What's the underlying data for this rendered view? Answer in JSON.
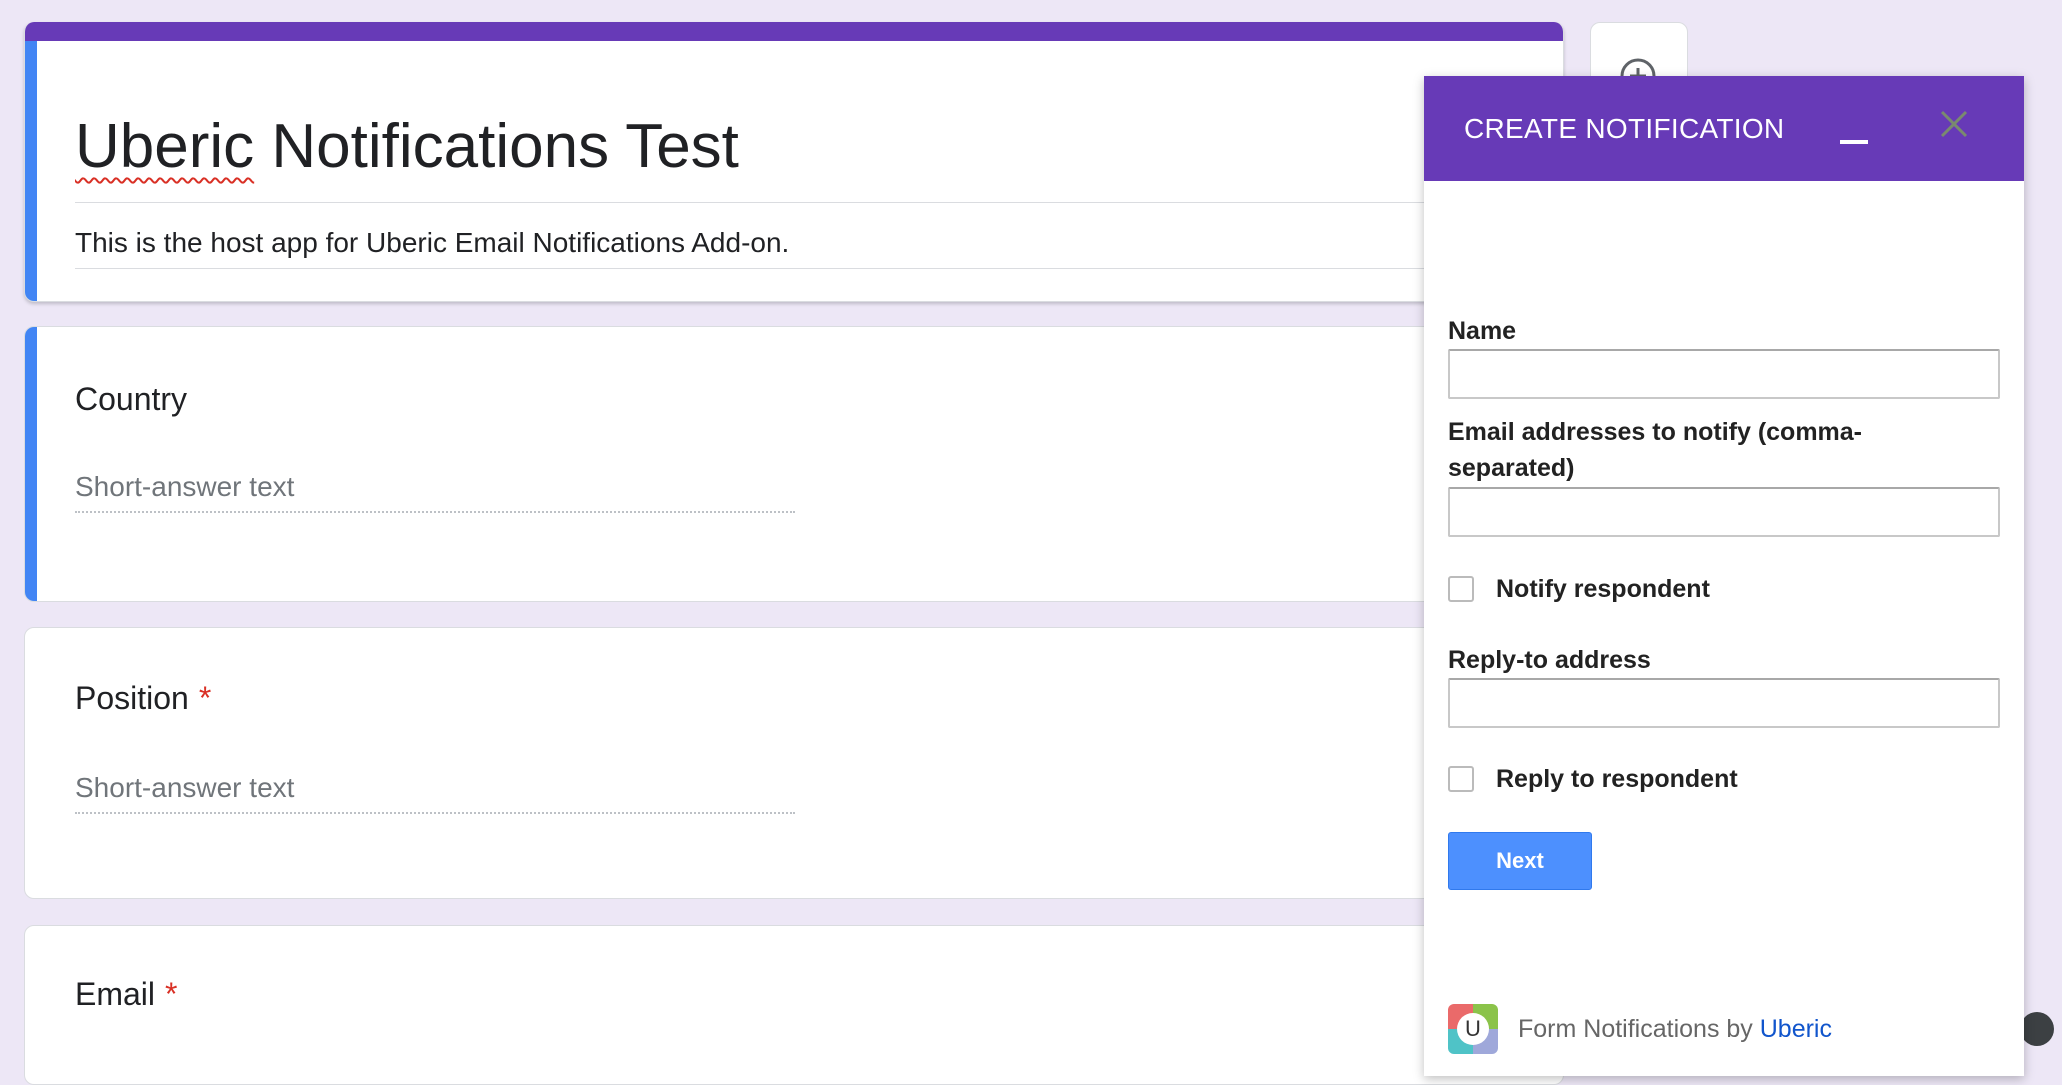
{
  "form": {
    "title": {
      "misspelled_word": "Uberic",
      "rest": " Notifications Test"
    },
    "description": "This is the host app for Uberic Email Notifications Add-on.",
    "questions": [
      {
        "title": "Country",
        "required_mark": "",
        "placeholder": "Short-answer text"
      },
      {
        "title": "Position",
        "required_mark": "*",
        "placeholder": "Short-answer text"
      },
      {
        "title": "Email",
        "required_mark": "*"
      }
    ]
  },
  "toolbar": {
    "add_icon": "add-circle-icon"
  },
  "sidebar": {
    "title": "CREATE NOTIFICATION",
    "minimize_icon": "minimize-icon",
    "close_icon": "close-icon",
    "fields": {
      "name_label": "Name",
      "name_value": "",
      "emails_label": "Email addresses to notify (comma-separated)",
      "emails_value": "",
      "notify_respondent_label": "Notify respondent",
      "notify_respondent_checked": false,
      "reply_to_label": "Reply-to address",
      "reply_to_value": "",
      "reply_to_respondent_label": "Reply to respondent",
      "reply_to_respondent_checked": false
    },
    "next_button": "Next",
    "footer": {
      "logo_letter": "U",
      "text": "Form Notifications by ",
      "link": "Uberic"
    }
  },
  "colors": {
    "theme": "#673ab7",
    "accent_blue": "#4285f4",
    "button_blue": "#4d90fe",
    "link": "#1155cc",
    "required": "#d93025",
    "background": "#ede7f6"
  }
}
